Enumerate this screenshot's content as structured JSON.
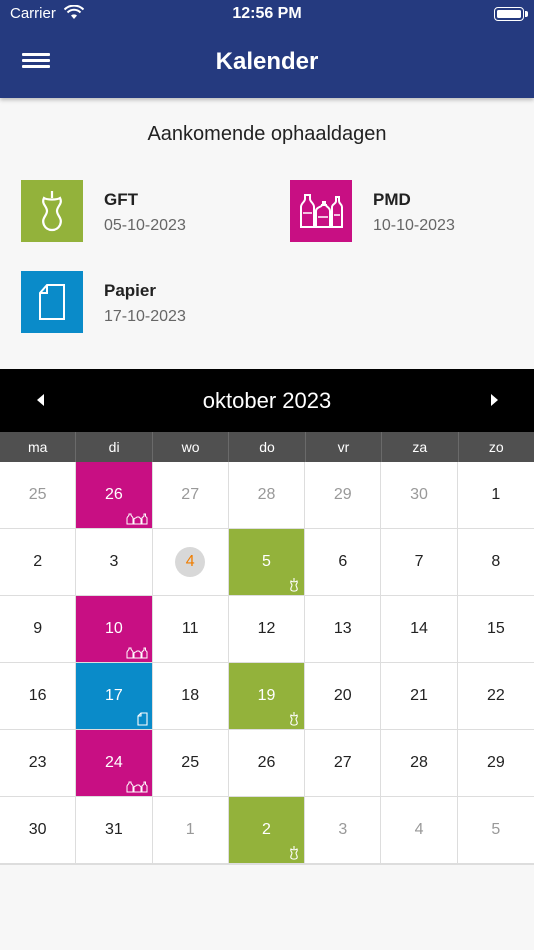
{
  "status_bar": {
    "carrier": "Carrier",
    "time": "12:56 PM"
  },
  "header": {
    "title": "Kalender",
    "menu_icon": "hamburger-icon"
  },
  "upcoming": {
    "title": "Aankomende ophaaldagen",
    "items": [
      {
        "name": "GFT",
        "date": "05-10-2023",
        "color": "#93b23b",
        "icon": "apple-core-icon"
      },
      {
        "name": "PMD",
        "date": "10-10-2023",
        "color": "#c80f83",
        "icon": "bottles-icon"
      },
      {
        "name": "Papier",
        "date": "17-10-2023",
        "color": "#0a8bc9",
        "icon": "paper-icon"
      }
    ]
  },
  "calendar": {
    "month": "oktober 2023",
    "weekdays": [
      "ma",
      "di",
      "wo",
      "do",
      "vr",
      "za",
      "zo"
    ],
    "days": [
      {
        "d": "25",
        "other": true
      },
      {
        "d": "26",
        "type": "pmd"
      },
      {
        "d": "27",
        "other": true
      },
      {
        "d": "28",
        "other": true
      },
      {
        "d": "29",
        "other": true
      },
      {
        "d": "30",
        "other": true
      },
      {
        "d": "1"
      },
      {
        "d": "2"
      },
      {
        "d": "3"
      },
      {
        "d": "4",
        "today": true
      },
      {
        "d": "5",
        "type": "gft"
      },
      {
        "d": "6"
      },
      {
        "d": "7"
      },
      {
        "d": "8"
      },
      {
        "d": "9"
      },
      {
        "d": "10",
        "type": "pmd"
      },
      {
        "d": "11"
      },
      {
        "d": "12"
      },
      {
        "d": "13"
      },
      {
        "d": "14"
      },
      {
        "d": "15"
      },
      {
        "d": "16"
      },
      {
        "d": "17",
        "type": "papier"
      },
      {
        "d": "18"
      },
      {
        "d": "19",
        "type": "gft"
      },
      {
        "d": "20"
      },
      {
        "d": "21"
      },
      {
        "d": "22"
      },
      {
        "d": "23"
      },
      {
        "d": "24",
        "type": "pmd"
      },
      {
        "d": "25"
      },
      {
        "d": "26"
      },
      {
        "d": "27"
      },
      {
        "d": "28"
      },
      {
        "d": "29"
      },
      {
        "d": "30"
      },
      {
        "d": "31"
      },
      {
        "d": "1",
        "other": true
      },
      {
        "d": "2",
        "type": "gft"
      },
      {
        "d": "3",
        "other": true
      },
      {
        "d": "4",
        "other": true
      },
      {
        "d": "5",
        "other": true
      }
    ]
  },
  "colors": {
    "header": "#253a7f",
    "gft": "#93b23b",
    "pmd": "#c80f83",
    "papier": "#0a8bc9",
    "today_text": "#f07d00"
  }
}
